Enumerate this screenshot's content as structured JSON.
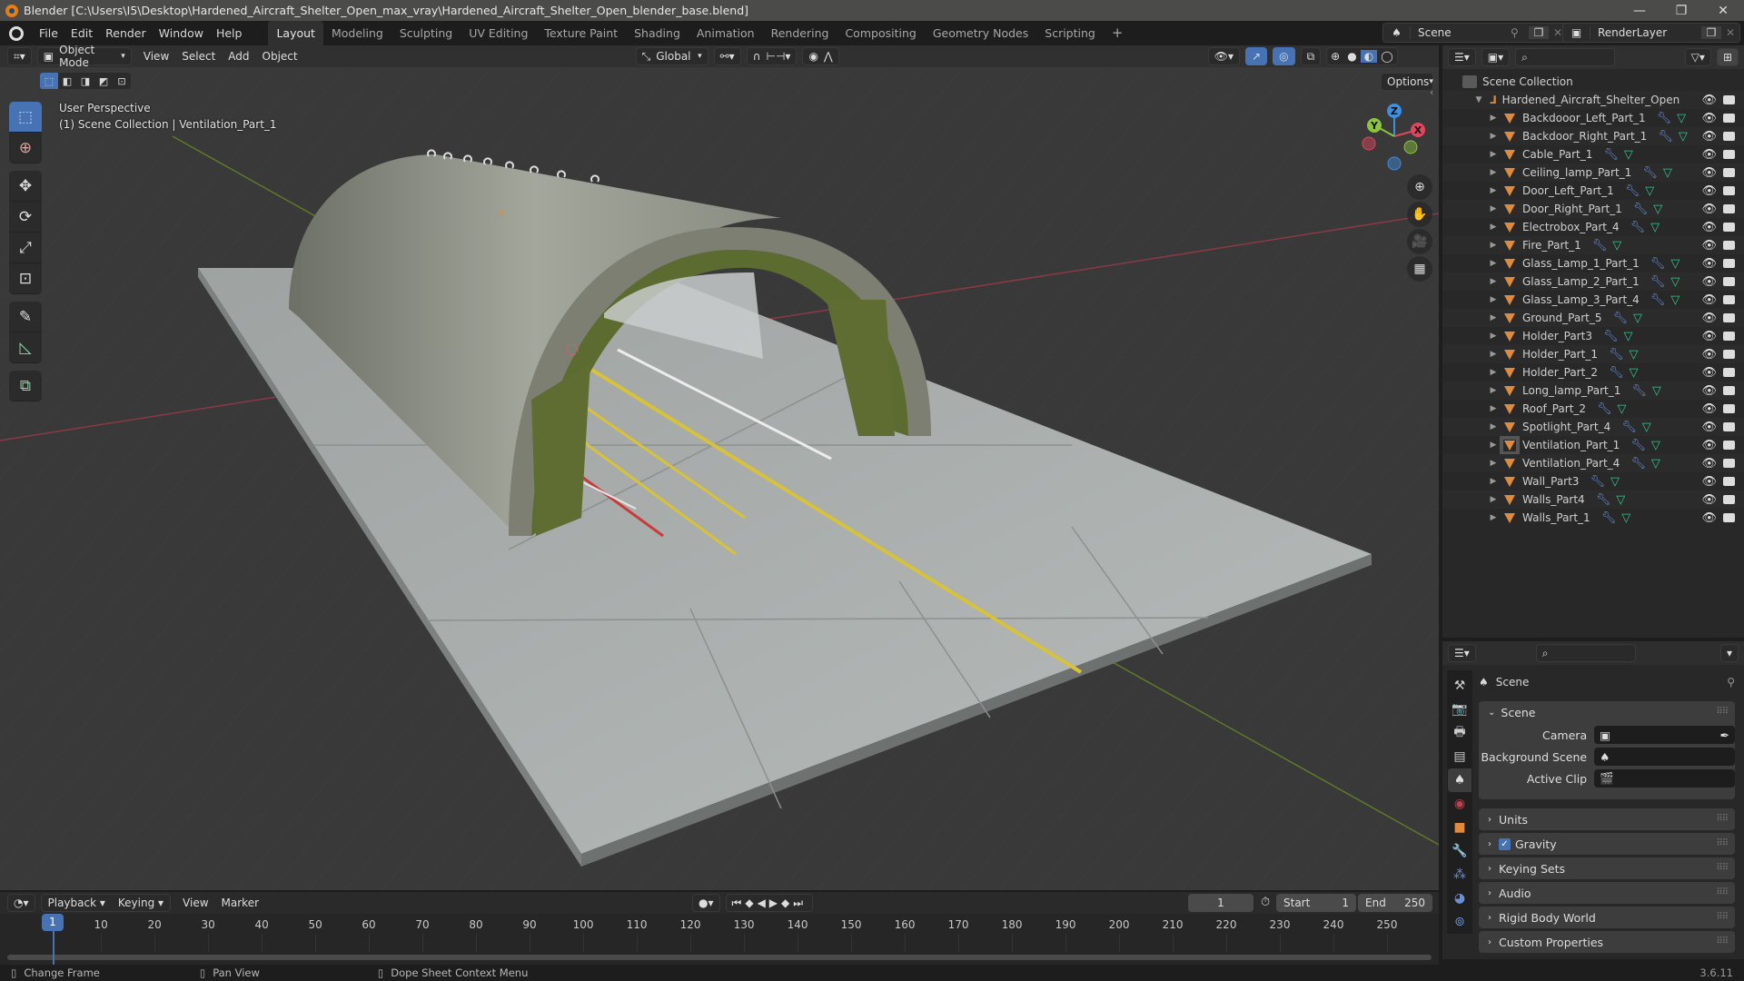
{
  "window": {
    "title": "Blender [C:\\Users\\I5\\Desktop\\Hardened_Aircraft_Shelter_Open_max_vray\\Hardened_Aircraft_Shelter_Open_blender_base.blend]",
    "controls": {
      "minimize": "—",
      "restore": "❐",
      "close": "✕"
    }
  },
  "menu": [
    "File",
    "Edit",
    "Render",
    "Window",
    "Help"
  ],
  "workspaces": [
    {
      "label": "Layout",
      "active": true
    },
    {
      "label": "Modeling"
    },
    {
      "label": "Sculpting"
    },
    {
      "label": "UV Editing"
    },
    {
      "label": "Texture Paint"
    },
    {
      "label": "Shading"
    },
    {
      "label": "Animation"
    },
    {
      "label": "Rendering"
    },
    {
      "label": "Compositing"
    },
    {
      "label": "Geometry Nodes"
    },
    {
      "label": "Scripting"
    }
  ],
  "add_workspace": "+",
  "scene_selector": {
    "value": "Scene"
  },
  "view_layer_selector": {
    "value": "RenderLayer"
  },
  "viewport": {
    "mode": "Object Mode",
    "menus": [
      "View",
      "Select",
      "Add",
      "Object"
    ],
    "orientation": "Global",
    "options_label": "Options",
    "overlay_title": "User Perspective",
    "overlay_subtitle": "(1) Scene Collection | Ventilation_Part_1",
    "gizmo": {
      "x": "X",
      "y": "Y",
      "z": "Z"
    },
    "colors": {
      "x": "#e0465c",
      "y": "#8bc53f",
      "z": "#3d8fe0",
      "accent": "#4772b3"
    },
    "tools": [
      "select-box",
      "cursor",
      "move",
      "rotate",
      "scale",
      "transform",
      "annotate",
      "measure",
      "add-cube"
    ]
  },
  "outliner": {
    "root": "Scene Collection",
    "collection": "Hardened_Aircraft_Shelter_Open",
    "items": [
      "Backdooor_Left_Part_1",
      "Backdoor_Right_Part_1",
      "Cable_Part_1",
      "Ceiling_lamp_Part_1",
      "Door_Left_Part_1",
      "Door_Right_Part_1",
      "Electrobox_Part_4",
      "Fire_Part_1",
      "Glass_Lamp_1_Part_1",
      "Glass_Lamp_2_Part_1",
      "Glass_Lamp_3_Part_4",
      "Ground_Part_5",
      "Holder_Part3",
      "Holder_Part_1",
      "Holder_Part_2",
      "Long_lamp_Part_1",
      "Roof_Part_2",
      "Spotlight_Part_4",
      "Ventilation_Part_1",
      "Ventilation_Part_4",
      "Wall_Part3",
      "Walls_Part4",
      "Walls_Part_1"
    ],
    "active_item": "Ventilation_Part_1"
  },
  "properties": {
    "context": "Scene",
    "scene_panel": {
      "title": "Scene",
      "fields": [
        {
          "label": "Camera",
          "value": ""
        },
        {
          "label": "Background Scene",
          "value": ""
        },
        {
          "label": "Active Clip",
          "value": ""
        }
      ]
    },
    "collapsed_panels": [
      {
        "label": "Units"
      },
      {
        "label": "Gravity",
        "checkbox": true,
        "checked": true
      },
      {
        "label": "Keying Sets"
      },
      {
        "label": "Audio"
      },
      {
        "label": "Rigid Body World"
      },
      {
        "label": "Custom Properties"
      }
    ]
  },
  "timeline": {
    "menus": [
      "Playback",
      "Keying",
      "View",
      "Marker"
    ],
    "current_frame": "1",
    "start_label": "Start",
    "start": "1",
    "end_label": "End",
    "end": "250",
    "ticks": [
      "10",
      "20",
      "30",
      "40",
      "50",
      "60",
      "70",
      "80",
      "90",
      "100",
      "110",
      "120",
      "130",
      "140",
      "150",
      "160",
      "170",
      "180",
      "190",
      "200",
      "210",
      "220",
      "230",
      "240",
      "250"
    ]
  },
  "statusbar": {
    "hints": [
      "Change Frame",
      "Pan View",
      "Dope Sheet Context Menu"
    ],
    "version": "3.6.11"
  }
}
